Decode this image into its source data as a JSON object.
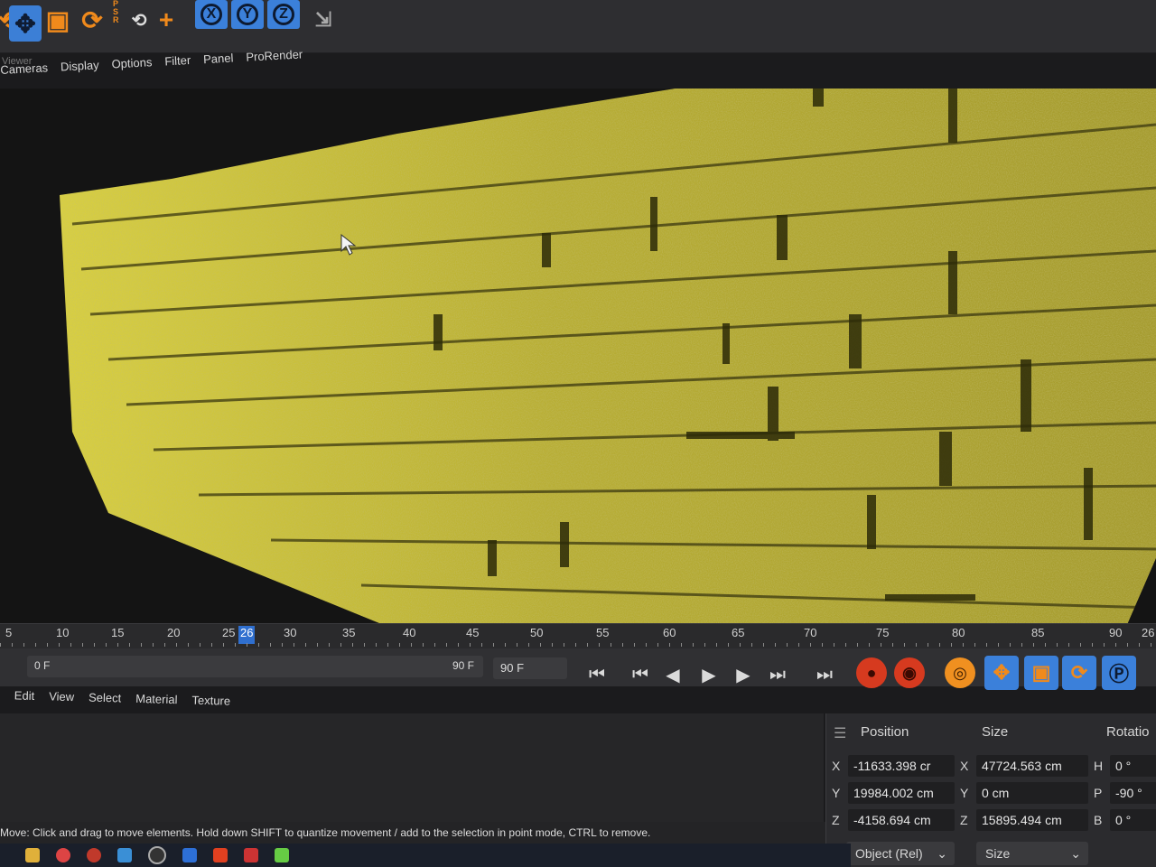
{
  "toolbar": {
    "psr_label": "P\nS\nR",
    "axis_x": "X",
    "axis_y": "Y",
    "axis_z": "Z"
  },
  "viewer": {
    "label": "Viewer",
    "menu": [
      "Cameras",
      "Display",
      "Options",
      "Filter",
      "Panel",
      "ProRender"
    ]
  },
  "timeline": {
    "ticks": [
      "5",
      "10",
      "15",
      "20",
      "25",
      "30",
      "35",
      "40",
      "45",
      "50",
      "55",
      "60",
      "65",
      "70",
      "75",
      "80",
      "85",
      "90"
    ],
    "current_frame": "26",
    "overflow_label": "26"
  },
  "controls": {
    "start_frame": "0 F",
    "range_end": "90 F",
    "end_frame": "90 F"
  },
  "material_menu": [
    "Edit",
    "View",
    "Select",
    "Material",
    "Texture"
  ],
  "coordinates": {
    "position_header": "Position",
    "size_header": "Size",
    "rotation_header": "Rotatio",
    "position": {
      "x_label": "X",
      "x": "-11633.398 cr",
      "y_label": "Y",
      "y": "19984.002 cm",
      "z_label": "Z",
      "z": "-4158.694 cm"
    },
    "size": {
      "x_label": "X",
      "x": "47724.563 cm",
      "y_label": "Y",
      "y": "0 cm",
      "z_label": "Z",
      "z": "15895.494 cm"
    },
    "rotation": {
      "h_label": "H",
      "h": "0 °",
      "p_label": "P",
      "p": "-90 °",
      "b_label": "B",
      "b": "0 °"
    },
    "mode_select": "Object (Rel)",
    "size_select": "Size"
  },
  "status_bar": {
    "text": "Move: Click and drag to move elements. Hold down SHIFT to quantize movement / add to the selection in point mode, CTRL to remove."
  },
  "colors": {
    "accent_blue": "#3b80da",
    "accent_orange": "#f08a1c",
    "record_red": "#d63a1f",
    "wall_yellow": "#c9c03a"
  }
}
